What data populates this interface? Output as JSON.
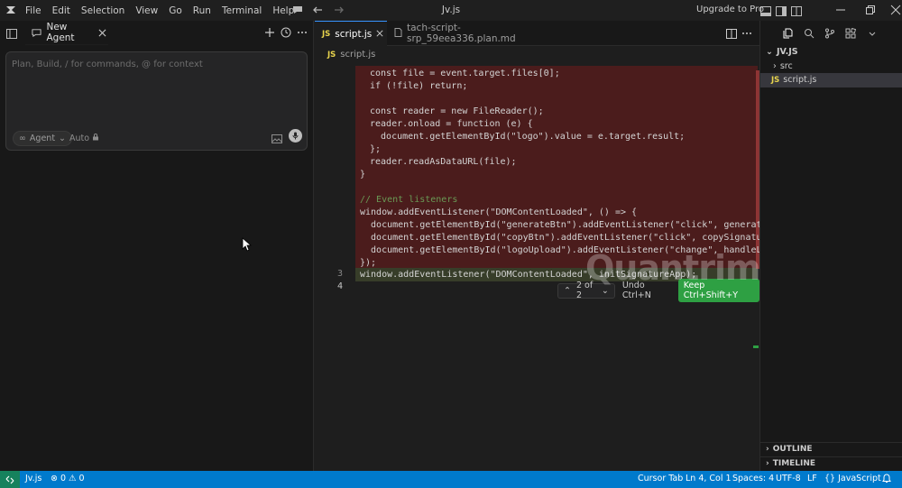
{
  "menu": [
    "File",
    "Edit",
    "Selection",
    "View",
    "Go",
    "Run",
    "Terminal",
    "Help"
  ],
  "window_title": "Jv.js",
  "upgrade_label": "Upgrade to Pro",
  "agent_panel": {
    "tab_label": "New Agent",
    "placeholder": "Plan, Build, / for commands, @ for context",
    "agent_mode": "Agent",
    "model": "Auto"
  },
  "editor": {
    "tabs": [
      {
        "label": "script.js",
        "badge": "JS"
      },
      {
        "label": "tach-script-srp_59eea336.plan.md",
        "badge": ""
      }
    ],
    "breadcrumb": {
      "badge": "JS",
      "file": "script.js"
    },
    "code_lines": [
      "const file = event.target.files[0];",
      "if (!file) return;",
      "",
      "const reader = new FileReader();",
      "reader.onload = function (e) {",
      "  document.getElementById(\"logo\").value = e.target.result;",
      "};",
      "reader.readAsDataURL(file);",
      "}",
      "",
      "// Event listeners",
      "window.addEventListener(\"DOMContentLoaded\", () => {",
      "  document.getElementById(\"generateBtn\").addEventListener(\"click\", generateSign",
      "  document.getElementById(\"copyBtn\").addEventListener(\"click\", copySignature);",
      "  document.getElementById(\"logoUpload\").addEventListener(\"change\", handleLogoUp",
      "});"
    ],
    "added_line": "window.addEventListener(\"DOMContentLoaded\", initSignatureApp);",
    "line_numbers": [
      "3",
      "4"
    ],
    "diff": {
      "counter": "2 of 2",
      "undo": "Undo Ctrl+N",
      "keep": "Keep Ctrl+Shift+Y"
    }
  },
  "explorer": {
    "root": "JV.JS",
    "items": [
      {
        "label": "src",
        "type": "folder"
      },
      {
        "label": "script.js",
        "type": "file",
        "badge": "JS"
      }
    ],
    "outline": "OUTLINE",
    "timeline": "TIMELINE"
  },
  "status_bar": {
    "file": "Jv.js",
    "errors": "0",
    "warnings": "0",
    "cursor_tab": "Cursor Tab",
    "position": "Ln 4, Col 1",
    "spaces": "Spaces: 4",
    "encoding": "UTF-8",
    "eol": "LF",
    "language": "JavaScript"
  },
  "watermark": "Quantrimang",
  "colors": {
    "accent": "#007acc",
    "keep": "#2ea043",
    "removed_bg": "#4b1c1c",
    "added_bg": "#373d29"
  }
}
